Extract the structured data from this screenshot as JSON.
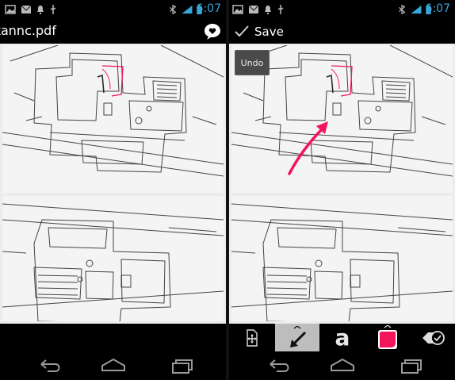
{
  "status_bar": {
    "time": "6:07",
    "icons": [
      "image-icon",
      "mail-icon",
      "notification-icon",
      "usb-icon",
      "bluetooth-icon",
      "signal-icon",
      "battery-icon"
    ]
  },
  "left_screen": {
    "title": "kannc.pdf",
    "annotate_icon": "speech-bubble-heart-icon"
  },
  "right_screen": {
    "save_label": "Save",
    "undo_label": "Undo",
    "tools": [
      {
        "name": "move",
        "icon": "move-arrows-icon"
      },
      {
        "name": "arrow",
        "icon": "arrow-icon",
        "active": true
      },
      {
        "name": "text",
        "label": "a"
      },
      {
        "name": "color",
        "icon": "color-swatch-icon",
        "color": "#f4145a"
      },
      {
        "name": "done",
        "icon": "eraser-check-icon"
      }
    ]
  },
  "navigation": {
    "buttons": [
      "back-icon",
      "home-icon",
      "recents-icon"
    ]
  },
  "colors": {
    "annotation": "#f4145a",
    "clock": "#3aa6d8",
    "active_tool_bg": "#bdbdbd"
  }
}
